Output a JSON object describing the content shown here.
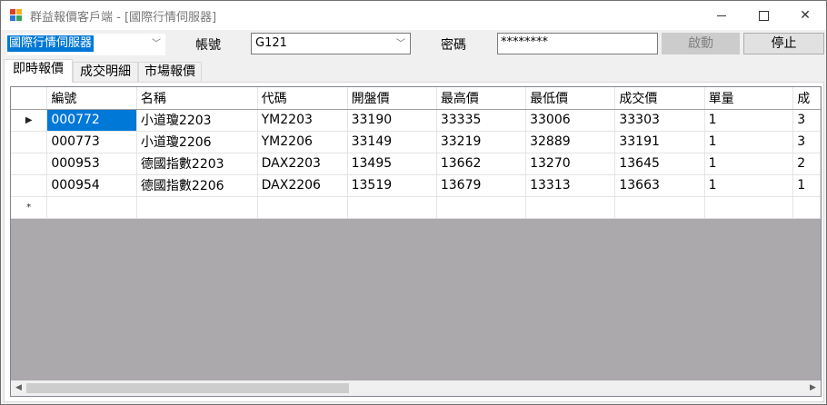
{
  "window": {
    "title": "群益報價客戶端 - [國際行情伺服器]"
  },
  "server_select": {
    "value": "國際行情伺服器"
  },
  "account": {
    "label": "帳號",
    "value": "G121"
  },
  "password": {
    "label": "密碼",
    "value": "********"
  },
  "buttons": {
    "start": "啟動",
    "stop": "停止"
  },
  "tabs": [
    "即時報價",
    "成交明細",
    "市場報價"
  ],
  "grid": {
    "columns": [
      "編號",
      "名稱",
      "代碼",
      "開盤價",
      "最高價",
      "最低價",
      "成交價",
      "單量",
      "成"
    ],
    "rows": [
      [
        "000772",
        "小道瓊2203",
        "YM2203",
        "33190",
        "33335",
        "33006",
        "33303",
        "1",
        "3"
      ],
      [
        "000773",
        "小道瓊2206",
        "YM2206",
        "33149",
        "33219",
        "32889",
        "33191",
        "1",
        "3"
      ],
      [
        "000953",
        "德國指數2203",
        "DAX2203",
        "13495",
        "13662",
        "13270",
        "13645",
        "1",
        "2"
      ],
      [
        "000954",
        "德國指數2206",
        "DAX2206",
        "13519",
        "13679",
        "13313",
        "13663",
        "1",
        "1"
      ]
    ],
    "current_row_marker": "▶",
    "new_row_marker": "*"
  },
  "colors": {
    "selection": "#0078d7",
    "grid_background": "#aba9ac"
  },
  "icons": {
    "app": "app-icon",
    "minimize": "minimize-icon",
    "maximize": "maximize-icon",
    "close": "close-icon",
    "dropdown": "chevron-down-icon"
  }
}
